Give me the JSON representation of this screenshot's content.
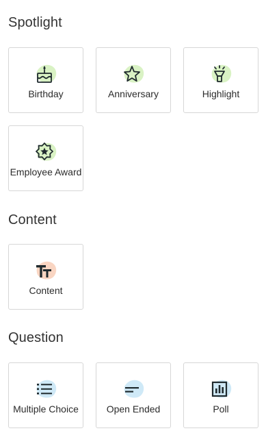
{
  "sections": [
    {
      "title": "Spotlight",
      "items": [
        {
          "label": "Birthday",
          "icon": "birthday-cake-icon"
        },
        {
          "label": "Anniversary",
          "icon": "star-icon"
        },
        {
          "label": "Highlight",
          "icon": "spotlight-icon"
        },
        {
          "label": "Employee Award",
          "icon": "award-badge-icon"
        }
      ]
    },
    {
      "title": "Content",
      "items": [
        {
          "label": "Content",
          "icon": "text-size-icon"
        }
      ]
    },
    {
      "title": "Question",
      "items": [
        {
          "label": "Multiple Choice",
          "icon": "list-icon"
        },
        {
          "label": "Open Ended",
          "icon": "text-lines-icon"
        },
        {
          "label": "Poll",
          "icon": "bar-chart-icon"
        }
      ]
    }
  ],
  "colors": {
    "spotlight_blob": "#d9f2c4",
    "content_blob": "#f9d5c2",
    "question_blob": "#cfe9f7",
    "icon_stroke": "#1f2a2e",
    "tile_border": "#d6d6d6"
  }
}
